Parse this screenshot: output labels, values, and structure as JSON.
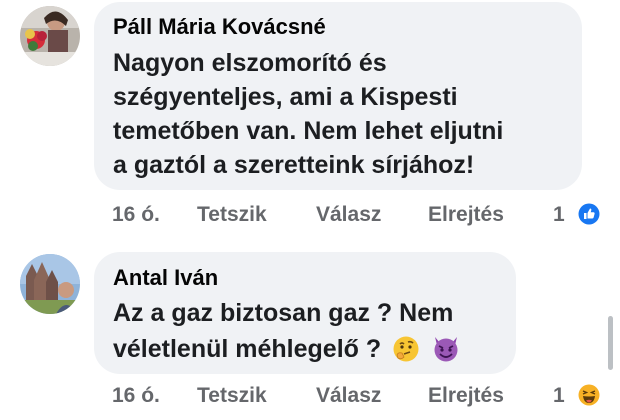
{
  "comments": [
    {
      "author": "Páll Mária Kovácsné",
      "lines": [
        "Nagyon elszomorító és",
        "szégyenteljes, ami a Kispesti",
        "temetőben van. Nem lehet eljutni",
        "a gaztól a szeretteink sírjához!"
      ],
      "time": "16 ó.",
      "like_label": "Tetszik",
      "reply_label": "Válasz",
      "hide_label": "Elrejtés",
      "reaction_count": "1",
      "reaction_icon": "like-icon"
    },
    {
      "author": "Antal Iván",
      "lines": [
        "Az a gaz biztosan gaz ? Nem",
        "véletlenül méhlegelő ?"
      ],
      "emojis": [
        "thinking-face-icon",
        "smiling-devil-icon"
      ],
      "time": "16 ó.",
      "like_label": "Tetszik",
      "reply_label": "Válasz",
      "hide_label": "Elrejtés",
      "reaction_count": "1",
      "reaction_icon": "haha-icon"
    }
  ],
  "colors": {
    "bubble": "#f0f2f5",
    "meta_text": "#65676b",
    "like_blue": "#1877f2",
    "haha_yellow": "#f7b125"
  }
}
